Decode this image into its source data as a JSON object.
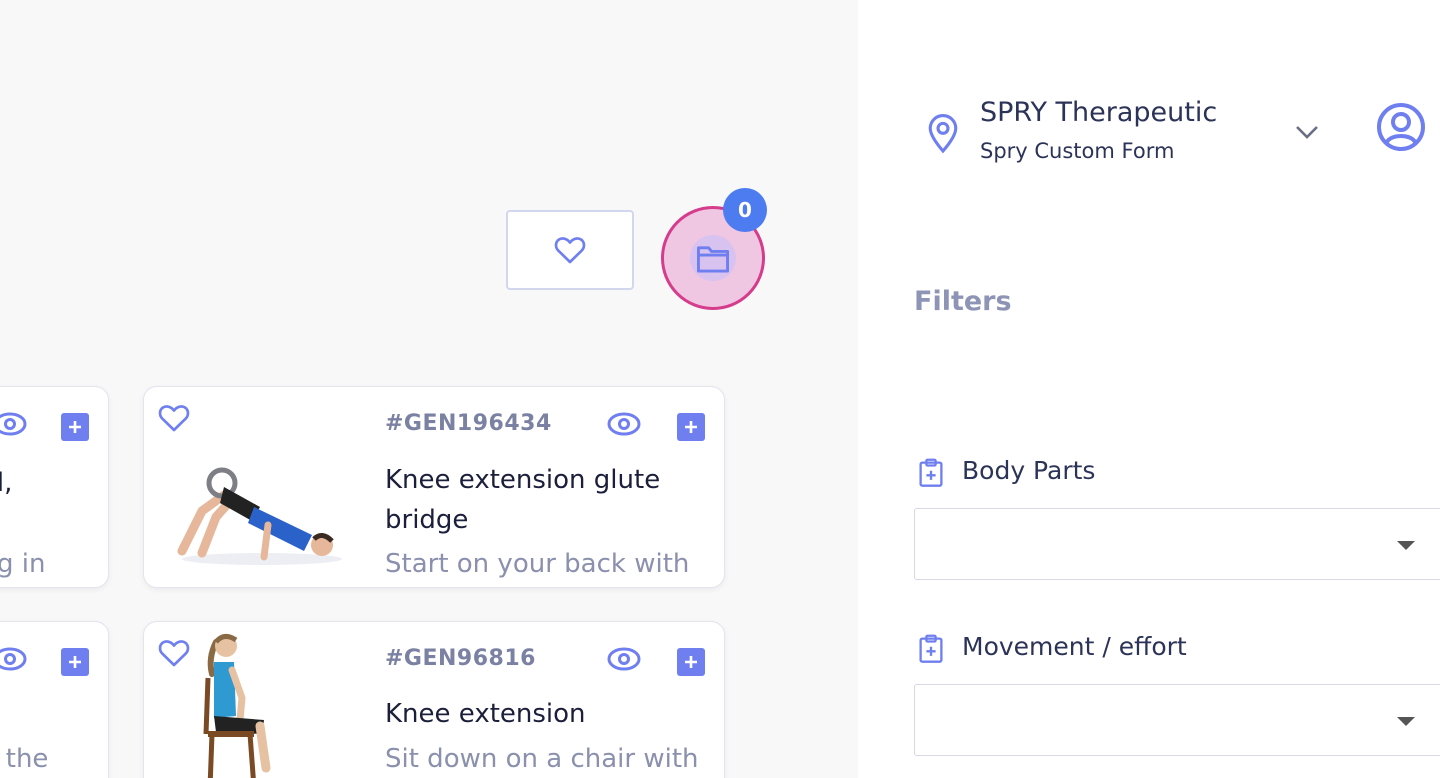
{
  "colors": {
    "accent": "#6f7ff0",
    "badge": "#4d7cf1",
    "highlight_ring": "#d63c8c",
    "title_text": "#1b1f3b",
    "muted_text": "#8a90ad"
  },
  "toolbar": {
    "favorites_icon": "heart-icon",
    "folder_icon": "folder-icon",
    "folder_count": "0"
  },
  "exercises": [
    {
      "partial": true,
      "title_line1": "al,",
      "desc": "eg in"
    },
    {
      "code": "#GEN196434",
      "title_line1": "Knee extension glute",
      "title_line2": "bridge",
      "desc": "Start on your back with"
    },
    {
      "partial": true,
      "desc": "n the"
    },
    {
      "code": "#GEN96816",
      "title_line1": "Knee extension",
      "desc": "Sit down on a chair with"
    }
  ],
  "sidebar": {
    "org_name": "SPRY Therapeutic",
    "org_sub": "Spry Custom Form",
    "filters_title": "Filters",
    "filters": [
      {
        "label": "Body Parts",
        "value": ""
      },
      {
        "label": "Movement / effort",
        "value": ""
      }
    ]
  }
}
